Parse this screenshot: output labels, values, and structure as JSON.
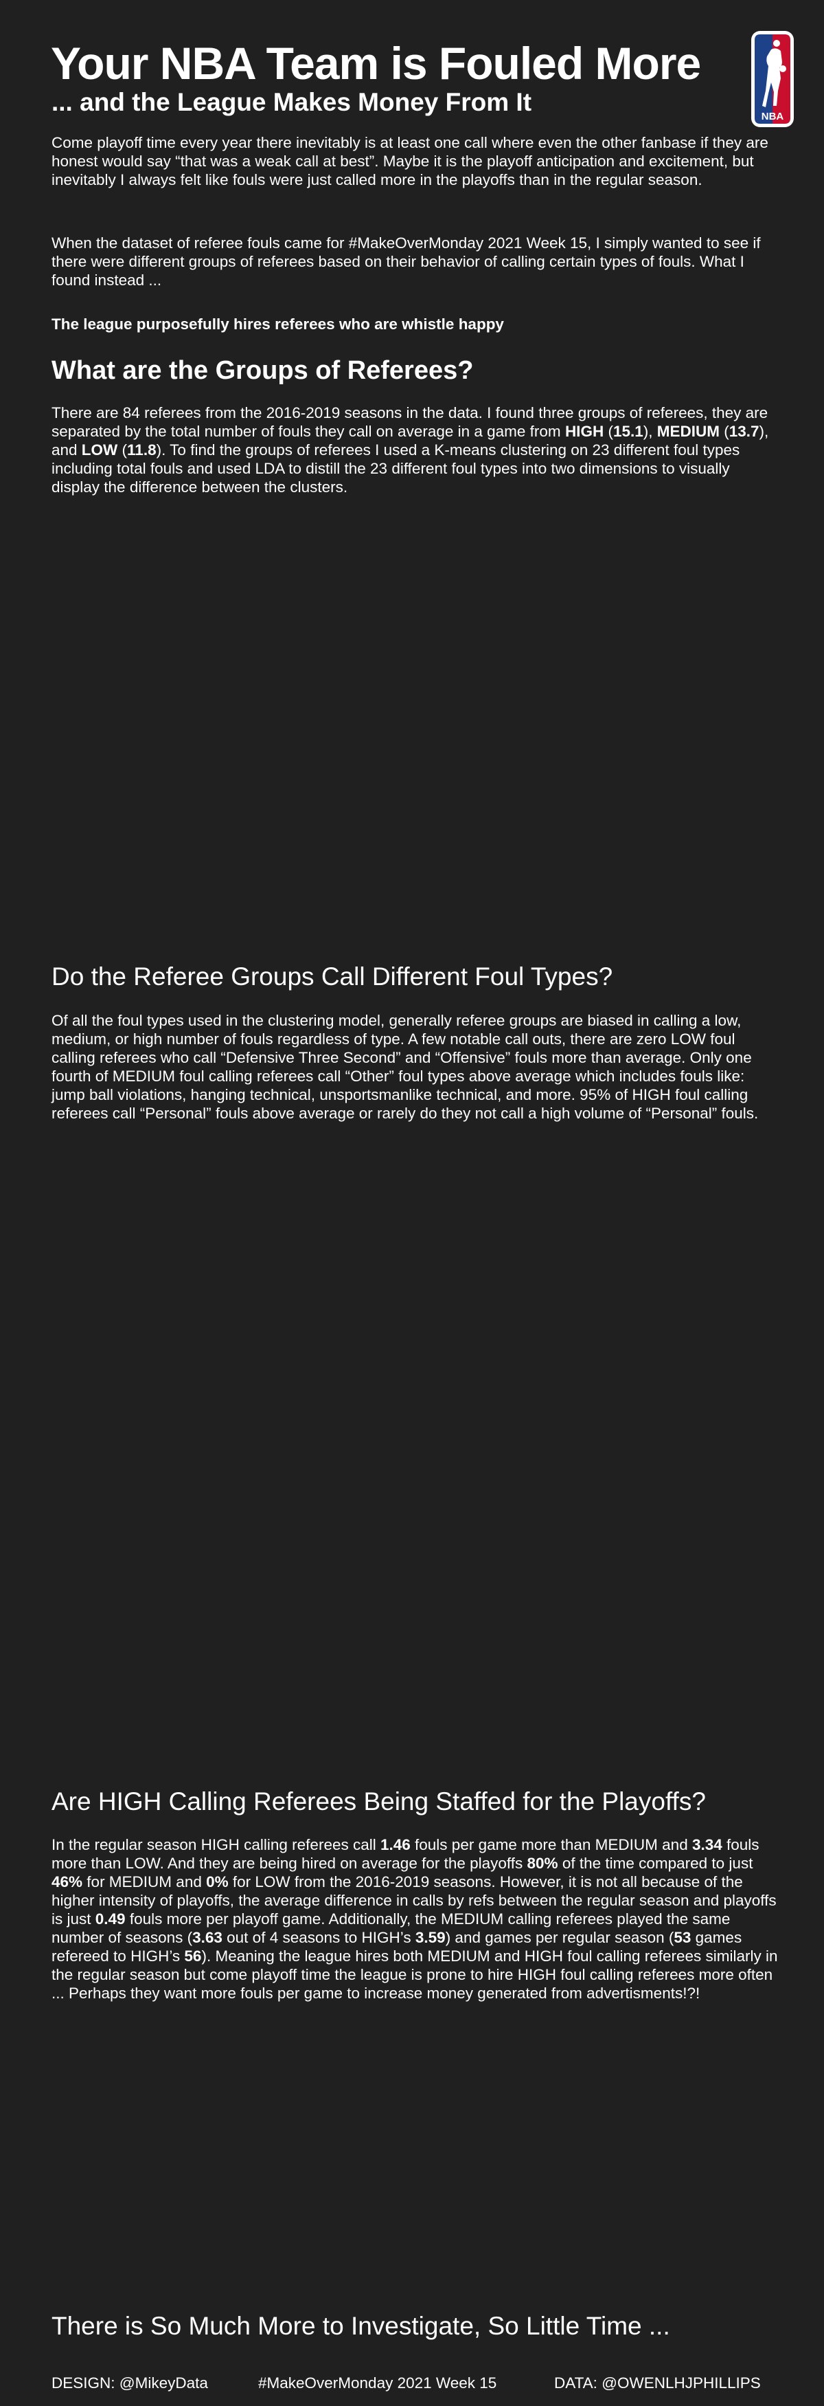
{
  "header": {
    "title": "Your NBA Team is Fouled More",
    "subtitle": "... and the League Makes Money From It",
    "logo_text": "NBA"
  },
  "intro": {
    "p1": "Come playoff time every year there inevitably is at least one call where even the other fanbase if they are honest would say “that was a weak call at best”. Maybe it is the playoff anticipation and excitement, but inevitably I always felt like fouls were just called more in the playoffs than in the regular season.",
    "p2": "When the dataset of referee fouls came for #MakeOverMonday 2021 Week 15, I simply wanted to see if there were different groups of referees based on their behavior of calling certain types of fouls. What I found instead ...",
    "bold": "The league purposefully hires referees who are whistle happy"
  },
  "section1": {
    "heading": "What are the Groups of Referees?",
    "text_a": "There are 84 referees from the 2016-2019 seasons in the data. I found three groups of referees, they are separated by the total number of fouls they call on average in a game from ",
    "high_label": "HIGH",
    "high_value": "15.1",
    "medium_label": "MEDIUM",
    "medium_value": "13.7",
    "low_label": "LOW",
    "low_value": "11.8",
    "sep_open": " (",
    "sep_close_comma": "), ",
    "and_text": "), and ",
    "text_b": "). To find the groups of referees I used a K-means clustering on 23 different foul types including total fouls and used LDA to distill the 23 different foul types into two dimensions to visually display the difference between the clusters."
  },
  "section2": {
    "heading": "Do the Referee Groups Call Different Foul Types?",
    "text": "Of all the foul types used in the clustering model, generally referee groups are biased in calling a low, medium, or high number of fouls regardless of type. A few notable call outs, there are zero LOW foul calling referees who call “Defensive Three Second” and “Offensive” fouls more than average. Only one fourth of MEDIUM foul calling referees call “Other” foul types above average which includes fouls like: jump ball violations, hanging technical, unsportsmanlike technical, and more. 95% of HIGH foul calling referees call “Personal” fouls above average or rarely do they not call a high volume of “Personal” fouls."
  },
  "section3": {
    "heading": "Are HIGH Calling Referees Being Staffed for the Playoffs?",
    "t1": "In the regular season HIGH calling referees call ",
    "v1": "1.46",
    "t2": " fouls per game more than MEDIUM and ",
    "v2": "3.34",
    "t3": " fouls more than LOW. And they are being hired on average for the playoffs ",
    "v3": "80%",
    "t4": " of the time compared to just ",
    "v4": "46%",
    "t5": " for MEDIUM and ",
    "v5": "0%",
    "t6": " for LOW from the 2016-2019 seasons. However, it is not all because of the higher intensity of playoffs, the average difference in calls by refs between the regular season and playoffs is just ",
    "v6": "0.49",
    "t7": " fouls more per playoff game. Additionally, the MEDIUM calling referees played the same number of seasons (",
    "v7": "3.63",
    "t8": " out of 4 seasons to HIGH’s ",
    "v8": "3.59",
    "t9": ") and games per regular season (",
    "v9": "53",
    "t10": " games refereed to HIGH’s ",
    "v10": "56",
    "t11": "). Meaning the league hires both MEDIUM and HIGH foul calling referees similarly in the regular season but come playoff time the league is prone to hire HIGH foul calling referees more often ... Perhaps they want more fouls per game to increase money generated from advertisments!?!"
  },
  "section4": {
    "heading": "There is So Much More to Investigate, So Little Time ..."
  },
  "footer": {
    "design": "DESIGN: @MikeyData",
    "event": "#MakeOverMonday 2021 Week 15",
    "data": "DATA: @OWENLHJPHILLIPS"
  },
  "colors": {
    "background": "#202020",
    "text": "#ffffff",
    "logo_blue": "#1d428a",
    "logo_red": "#c8102e"
  }
}
